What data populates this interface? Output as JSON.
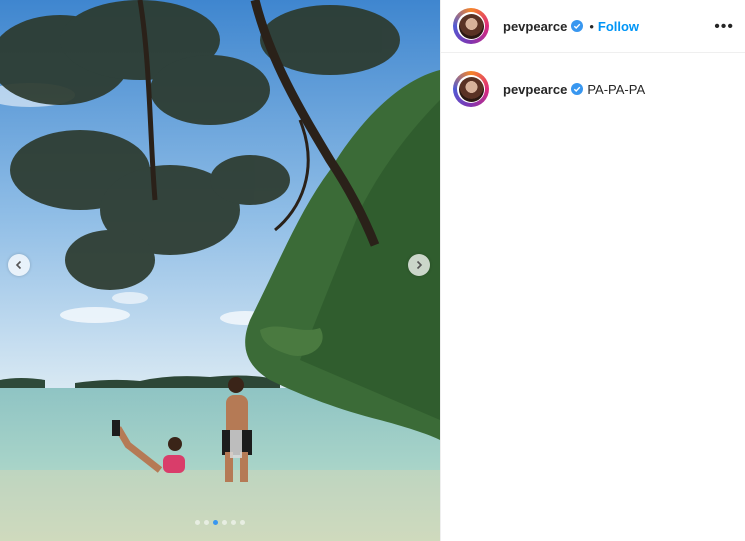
{
  "post": {
    "username": "pevpearce",
    "follow_label": "Follow",
    "separator": "•",
    "more_label": "•••",
    "caption_username": "pevpearce",
    "caption_text": "PA-PA-PA",
    "carousel": {
      "total": 6,
      "active_index": 2
    }
  },
  "colors": {
    "follow": "#0095f6",
    "verified": "#3897f0"
  },
  "icons": {
    "verified": "verified-badge-icon",
    "prev": "chevron-left-icon",
    "next": "chevron-right-icon",
    "more": "more-options-icon"
  }
}
